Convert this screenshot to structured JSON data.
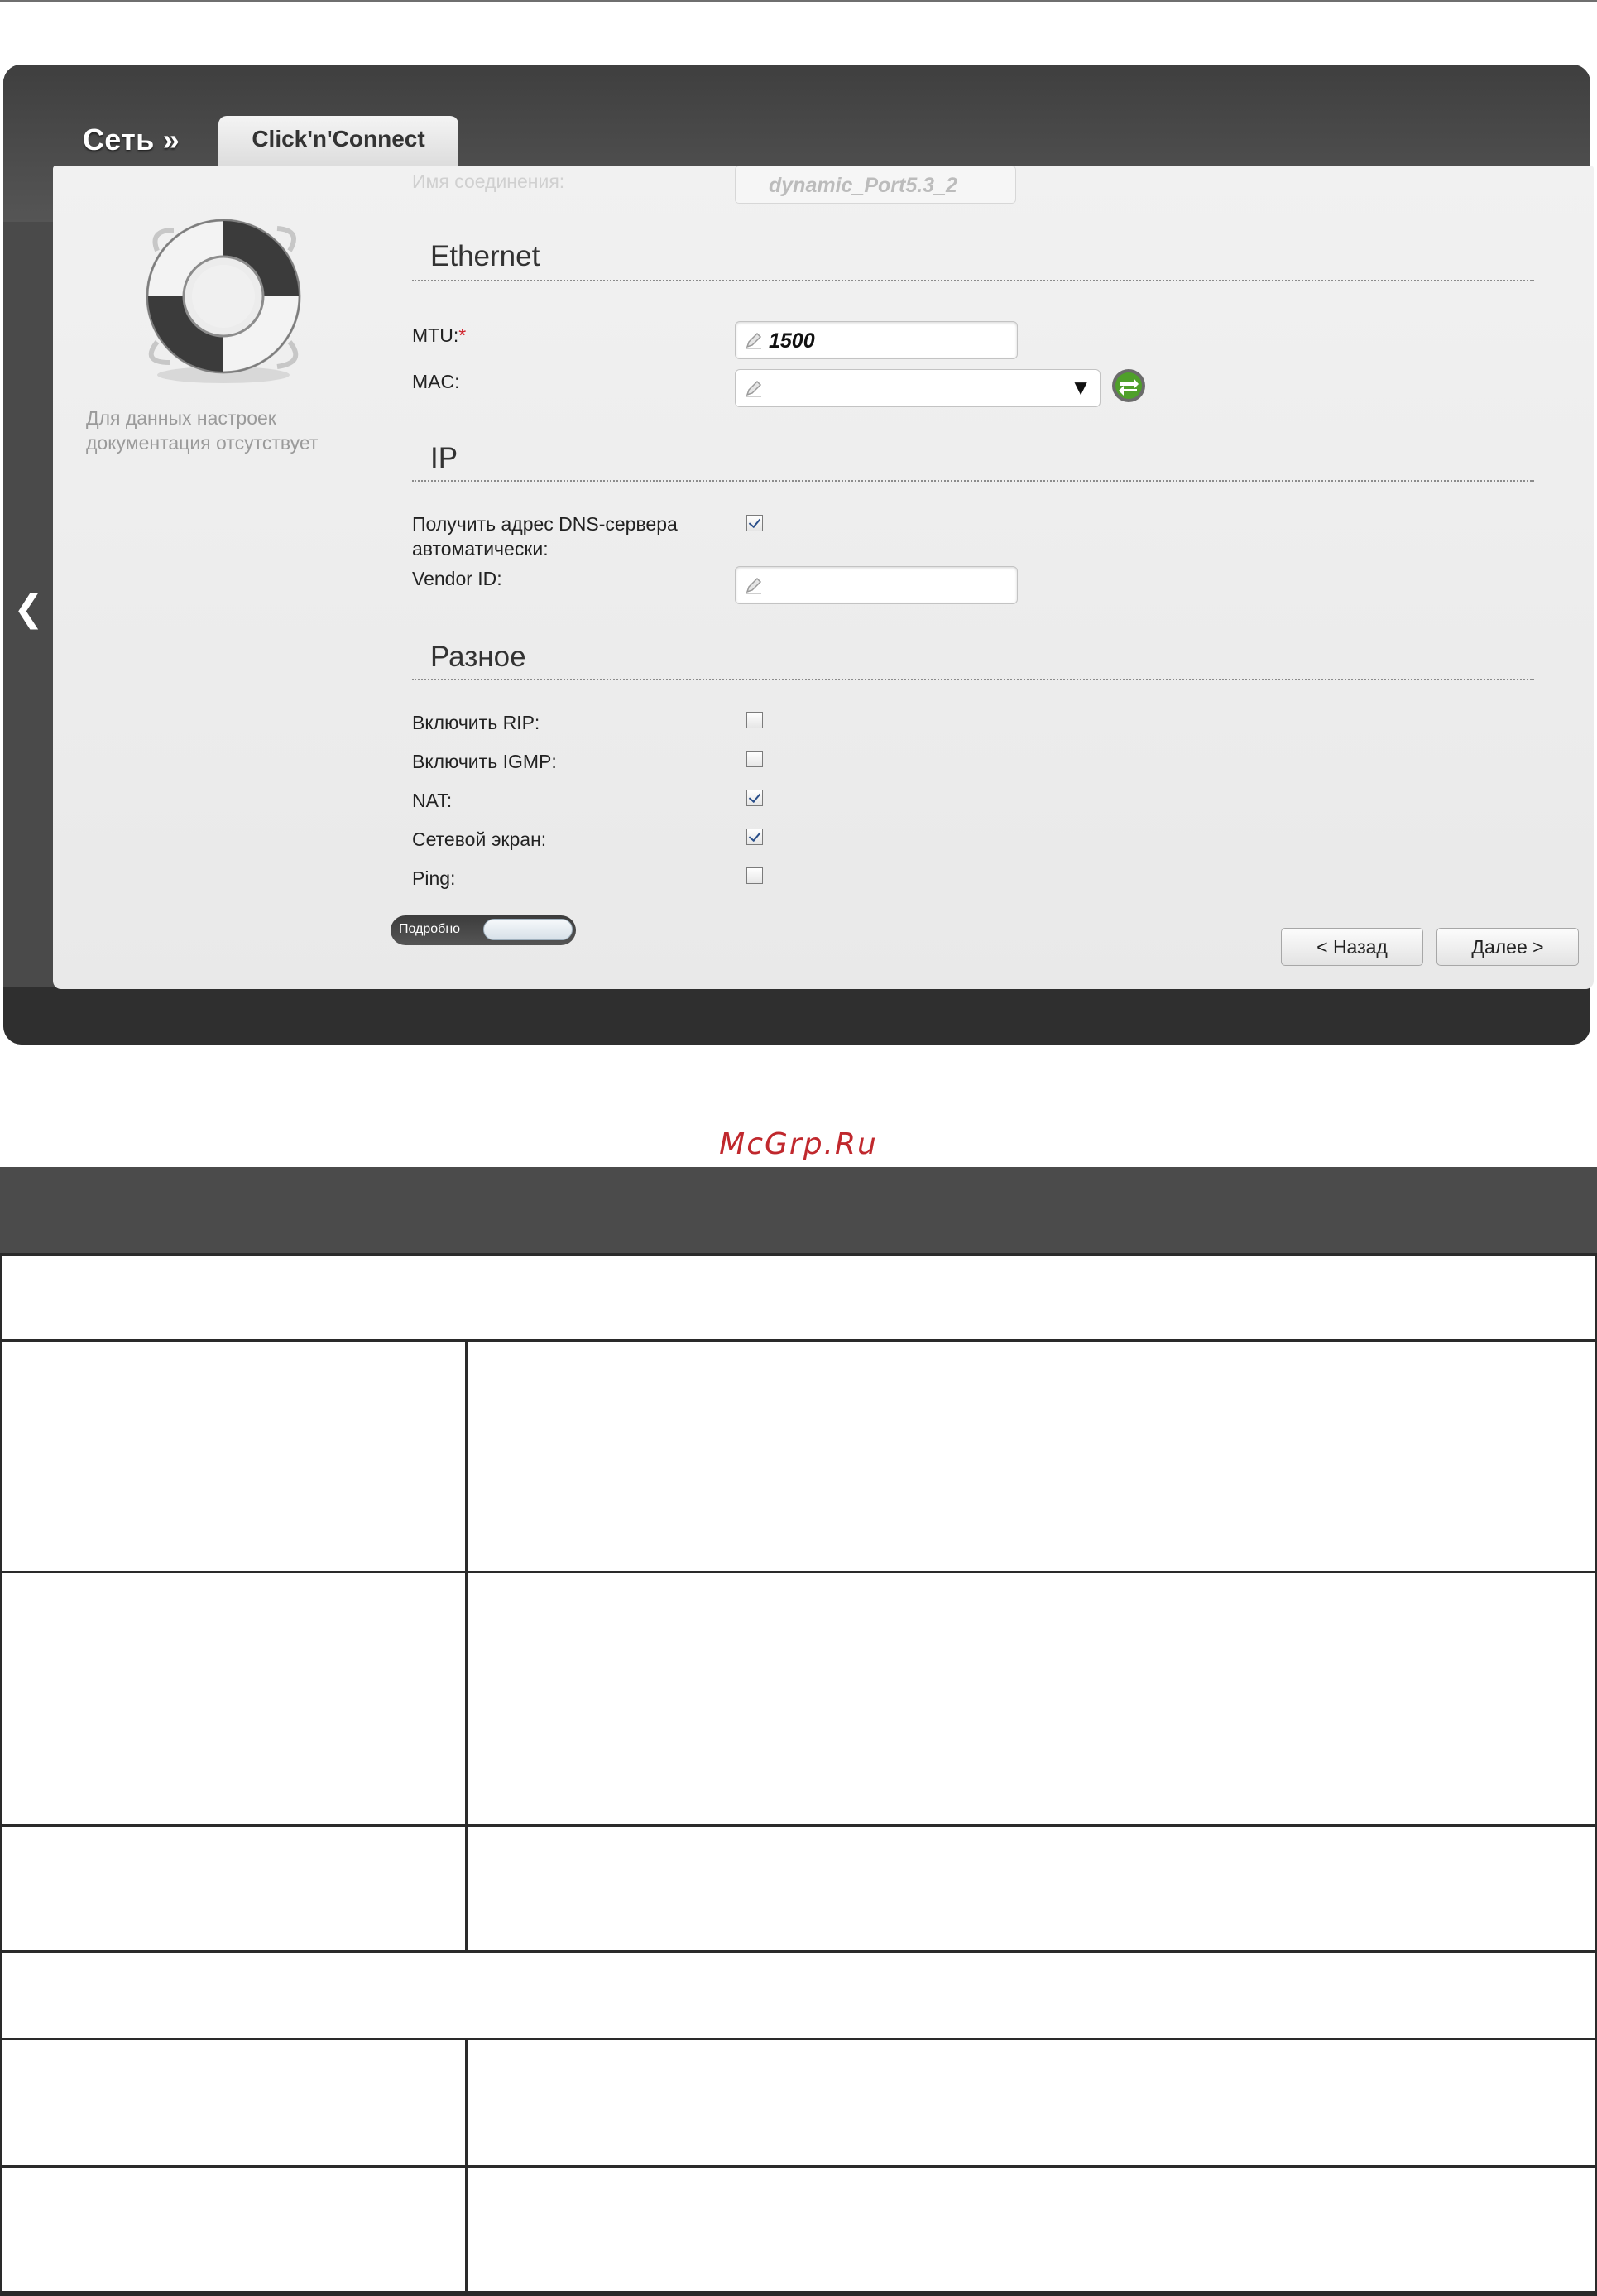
{
  "breadcrumb": "Сеть »",
  "tab": "Click'n'Connect",
  "help_note": "Для данных настроек документация отсутствует",
  "ghost_row": {
    "label": "Имя соединения:",
    "value": "dynamic_Port5.3_2"
  },
  "sections": {
    "ethernet": {
      "title": "Ethernet",
      "mtu_label": "MTU:",
      "mtu_required_mark": "*",
      "mtu_value": "1500",
      "mac_label": "MAC:"
    },
    "ip": {
      "title": "IP",
      "dns_auto_label": "Получить адрес DNS-сервера автоматически:",
      "dns_auto_checked": true,
      "vendor_id_label": "Vendor ID:"
    },
    "misc": {
      "title": "Разное",
      "rows": [
        {
          "label": "Включить RIP:",
          "checked": false
        },
        {
          "label": "Включить IGMP:",
          "checked": false
        },
        {
          "label": "NAT:",
          "checked": true
        },
        {
          "label": "Сетевой экран:",
          "checked": true
        },
        {
          "label": "Ping:",
          "checked": false
        }
      ]
    }
  },
  "toggle_label": "Подробно",
  "buttons": {
    "back": "< Назад",
    "next": "Далее >"
  },
  "watermark": "McGrp.Ru",
  "icons": [
    "back-arrow-icon",
    "lifebuoy-icon",
    "pencil-icon",
    "refresh-icon",
    "dropdown-triangle-icon"
  ]
}
